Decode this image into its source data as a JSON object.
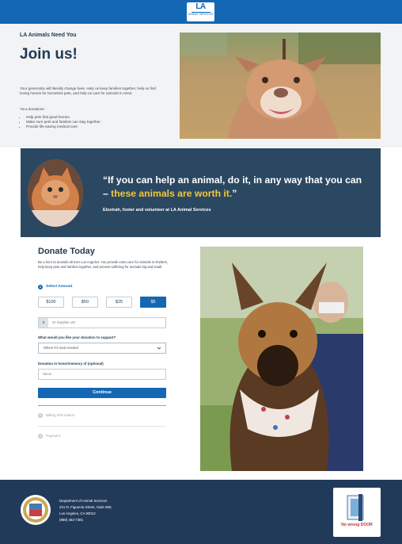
{
  "header": {
    "logo_text": "LA",
    "logo_subtext": "ANIMAL SERVICES"
  },
  "hero": {
    "kicker": "LA Animals Need You",
    "title": "Join us!",
    "intro": "Your generosity will literally change lives. Help us keep families together, help us find loving homes for homeless pets, and help us care for animals in need.",
    "donations_label": "Your donations:",
    "bullets": [
      "Help pets find good homes.",
      "Make sure pets and families can stay together.",
      "Provide life-saving medical care."
    ]
  },
  "quote": {
    "text_main": "“If you can help an animal, do it, in any way that you can – ",
    "text_highlight": "these animals are worth it.",
    "text_end": "”",
    "attribution": "Elextrah, foster and volunteer at LA Animal Services",
    "highlight_color": "#f3c83b"
  },
  "donate": {
    "title": "Donate Today",
    "intro": "Be a hero to animals all over Los Angeles. You provide extra care for animals in shelters, help keep pets and families together, and prevent suffering for animals big and small.",
    "step1_number": "1",
    "step1_label": "Select Amount",
    "amounts": [
      "$100",
      "$50",
      "$25",
      "$5"
    ],
    "selected_amount": "$5",
    "other_prefix": "$",
    "other_placeholder": "Or Surprise Us!",
    "support_label": "What would you like your donation to support?",
    "support_value": "Where it's most needed",
    "honor_label": "Donation in honor/memory of (optional)",
    "name_placeholder": "Name",
    "continue_label": "Continue",
    "step2_number": "2",
    "step2_label": "Billing Information",
    "step3_number": "3",
    "step3_label": "Payment",
    "accent_color": "#1467b3"
  },
  "footer": {
    "lines": [
      "Department of Animal Services",
      "221 N. Figueroa Street, Suite 600,",
      "Los Angeles, CA 90012",
      "(888) 452-7381"
    ],
    "badge_text": "No wrong DOOR"
  }
}
